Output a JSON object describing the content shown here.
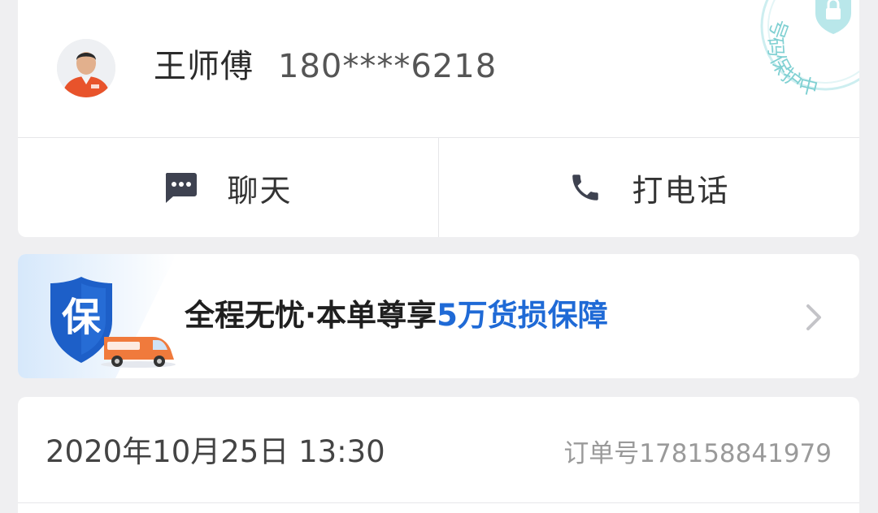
{
  "driver": {
    "name": "王师傅",
    "phone": "180****6218",
    "stamp_text": "号码保护中"
  },
  "actions": {
    "chat_label": "聊天",
    "call_label": "打电话"
  },
  "insurance": {
    "shield_char": "保",
    "text_prefix": "全程无忧·本单尊享",
    "text_highlight": "5万货损保障"
  },
  "order": {
    "time": "2020年10月25日 13:30",
    "number": "订单号178158841979"
  },
  "colors": {
    "accent_blue": "#1f6ad6",
    "stamp_teal": "#7fd0d2",
    "van_orange": "#f07a3c",
    "background": "#efeff1"
  },
  "icons": {
    "chat": "chat-bubble-icon",
    "call": "phone-icon",
    "shield": "shield-icon",
    "van": "van-icon",
    "chevron": "chevron-right-icon",
    "lock": "lock-icon"
  }
}
